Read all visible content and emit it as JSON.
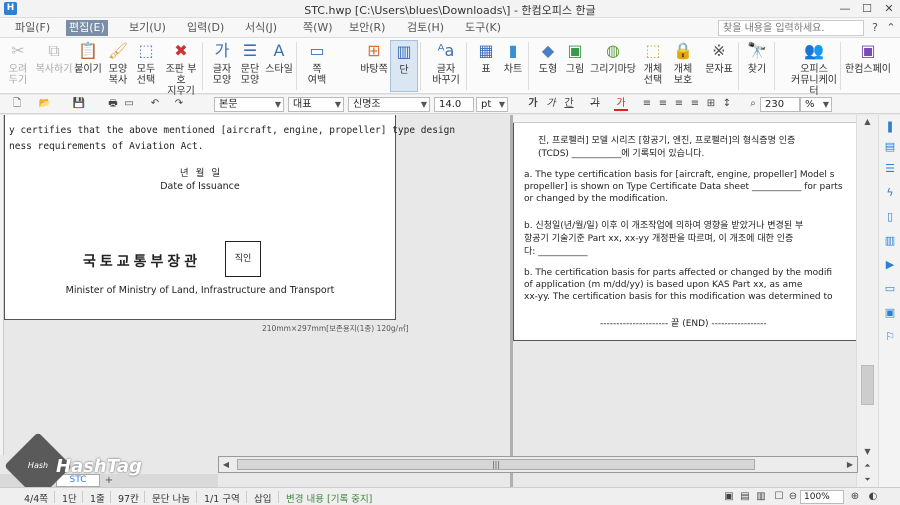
{
  "window": {
    "title": "STC.hwp [C:\\Users\\blues\\Downloads\\] - 한컴오피스 한글",
    "minimize": "—",
    "maximize": "☐",
    "close": "✕"
  },
  "menu": {
    "items": [
      "파일(F)",
      "편집(E)",
      "보기(U)",
      "입력(D)",
      "서식(J)",
      "쪽(W)",
      "보안(R)",
      "검토(H)",
      "도구(K)"
    ],
    "active": "편집(E)",
    "help_placeholder": "찾을 내용을 입력하세요."
  },
  "ribbon": {
    "buttons": [
      {
        "label": "오려\n두기",
        "icon": "scissors-icon",
        "disabled": true
      },
      {
        "label": "복사하기",
        "icon": "copy-icon",
        "disabled": true
      },
      {
        "label": "붙이기",
        "icon": "paste-icon"
      },
      {
        "label": "모양\n복사",
        "icon": "format-painter-icon"
      },
      {
        "label": "모두\n선택",
        "icon": "select-all-icon"
      },
      {
        "label": "조판 부호\n지우기",
        "icon": "clear-codes-icon"
      },
      {
        "label": "글자\n모양",
        "icon": "char-shape-icon"
      },
      {
        "label": "문단\n모양",
        "icon": "para-shape-icon"
      },
      {
        "label": "스타일",
        "icon": "style-icon"
      },
      {
        "label": "쪽\n여백",
        "icon": "page-margin-icon"
      },
      {
        "label": "바탕쪽",
        "icon": "master-page-icon"
      },
      {
        "label": "단",
        "icon": "columns-icon"
      },
      {
        "label": "글자\n바꾸기",
        "icon": "replace-char-icon"
      },
      {
        "label": "표",
        "icon": "table-icon"
      },
      {
        "label": "차트",
        "icon": "chart-icon"
      },
      {
        "label": "도형",
        "icon": "shape-icon"
      },
      {
        "label": "그림",
        "icon": "picture-icon"
      },
      {
        "label": "그리기마당",
        "icon": "clipart-icon"
      },
      {
        "label": "개체\n선택",
        "icon": "object-select-icon"
      },
      {
        "label": "개체\n보호",
        "icon": "object-protect-icon"
      },
      {
        "label": "문자표",
        "icon": "symbol-icon"
      },
      {
        "label": "찾기",
        "icon": "find-icon"
      },
      {
        "label": "오피스\n커뮤니케이터",
        "icon": "communicator-icon"
      },
      {
        "label": "한컴스페이",
        "icon": "hancom-space-icon"
      }
    ]
  },
  "format_bar": {
    "style": "본문",
    "language": "대표",
    "font": "신명조",
    "size": "14.0",
    "unit": "pt",
    "zoom": "230",
    "zoom_unit": "%",
    "bold": "가",
    "italic": "가",
    "underline": "간",
    "strike": "가",
    "color": "가"
  },
  "left_page": {
    "line1": "y certifies that the above mentioned [aircraft, engine, propeller] type design",
    "line2": "ness requirements of Aviation Act.",
    "date_korean": "년        월        일",
    "date_english": "Date of Issuance",
    "authority_korean": "국토교통부장관",
    "seal": "직인",
    "authority_english": "Minister of Ministry of Land, Infrastructure and Transport",
    "paper_info": "210mm×297mm[보존용지(1종) 120g/㎡]"
  },
  "right_page": {
    "lines": [
      "진, 프로펠러] 모델 시리즈 [항공기, 엔진, 프로펠러]의 형식증명 인증",
      "(TCDS) ___________에 기록되어 있습니다.",
      "a.  The type certification basis for [aircraft, engine, propeller] Model s",
      "     propeller] is shown on Type Certificate Data sheet ___________ for parts",
      "     or changed by the modification.",
      "b.  신청일(년/월/일) 이후 이 개조작업에 의하여 영향을 받았거나 변경된 부",
      "     항공기 기술기준 Part xx, xx-yy 개정판을 따르며, 이 개조에 대한 인증",
      "     다: ___________",
      "b.  The certification basis for parts affected or changed by the modifi",
      "     of application (m m/dd/yy) is based upon KAS Part xx, as ame",
      "     xx-yy. The certification basis for this modification was determined to",
      "---------------------  끝 (END)  -----------------"
    ]
  },
  "tabs": {
    "doc_tab": "STC",
    "add": "+"
  },
  "watermark": {
    "text": "HashTag",
    "badge": "Hash\nTag"
  },
  "status": {
    "page": "4/4쪽",
    "column": "1단",
    "line": "1줄",
    "char": "97칸",
    "section_break": "문단 나눔",
    "section": "1/1 구역",
    "insert": "삽입",
    "track_changes": "변경 내용 [기록 중지]",
    "zoom": "100%"
  }
}
